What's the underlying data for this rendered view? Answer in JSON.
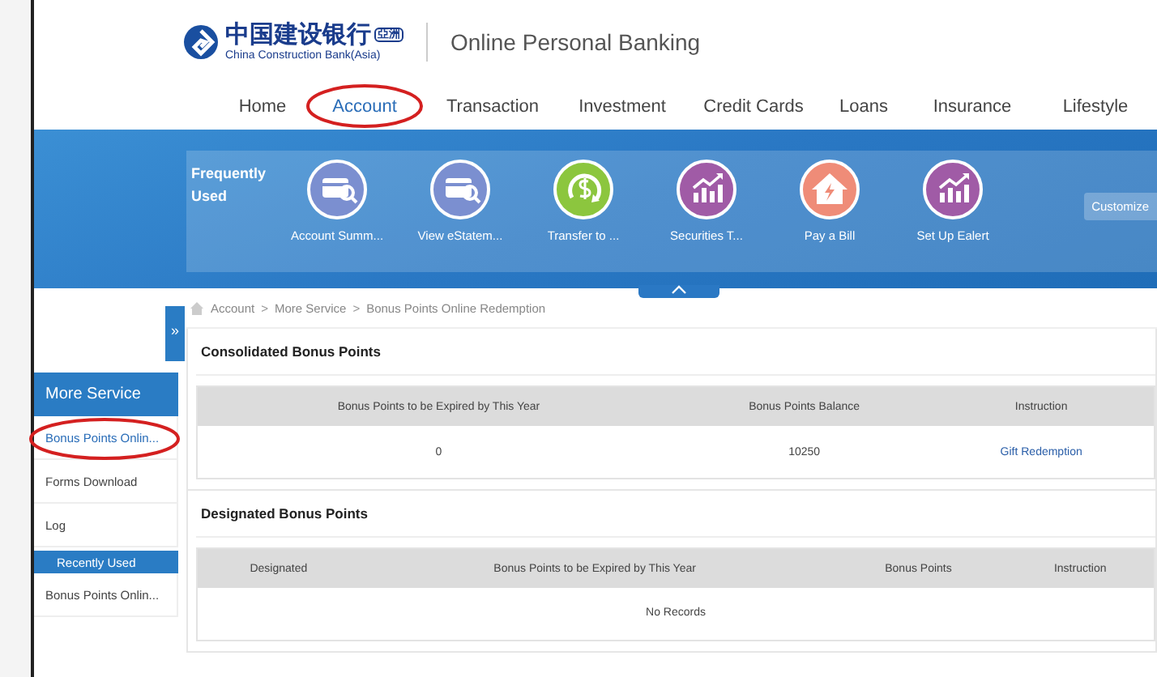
{
  "logo": {
    "chinese": "中国建设银行",
    "badge": "亞洲",
    "english": "China Construction Bank(Asia)"
  },
  "site_title": "Online Personal Banking",
  "nav": [
    {
      "label": "Home",
      "selected": false,
      "circled": false
    },
    {
      "label": "Account",
      "selected": true,
      "circled": true
    },
    {
      "label": "Transaction",
      "selected": false,
      "circled": false
    },
    {
      "label": "Investment",
      "selected": false,
      "circled": false
    },
    {
      "label": "Credit Cards",
      "selected": false,
      "circled": false
    },
    {
      "label": "Loans",
      "selected": false,
      "circled": false
    },
    {
      "label": "Insurance",
      "selected": false,
      "circled": false
    },
    {
      "label": "Lifestyle",
      "selected": false,
      "circled": false
    }
  ],
  "frequently_used": {
    "heading": "Frequently Used",
    "customize": "Customize",
    "items": [
      {
        "label": "Account Summ...",
        "kind": "card",
        "color": "#7b8fd0"
      },
      {
        "label": "View eStatem...",
        "kind": "card",
        "color": "#7b8fd0"
      },
      {
        "label": "Transfer to ...",
        "kind": "transfer",
        "color": "#8cc63e"
      },
      {
        "label": "Securities T...",
        "kind": "chart",
        "color": "#a05ba6"
      },
      {
        "label": "Pay a Bill",
        "kind": "house",
        "color": "#ef8c78"
      },
      {
        "label": "Set Up Ealert",
        "kind": "chart",
        "color": "#a05ba6"
      }
    ]
  },
  "expand_tab": "»",
  "sidebar": {
    "heading": "More Service",
    "items": [
      {
        "label": "Bonus Points Onlin...",
        "selected": true,
        "circled": true
      },
      {
        "label": "Forms Download",
        "selected": false,
        "circled": false
      },
      {
        "label": "Log",
        "selected": false,
        "circled": false
      }
    ],
    "recent_heading": "Recently Used",
    "recent_items": [
      {
        "label": "Bonus Points Onlin..."
      }
    ]
  },
  "breadcrumb": {
    "separator": ">",
    "items": [
      "Account",
      "More Service",
      "Bonus Points Online Redemption"
    ]
  },
  "consolidated": {
    "title": "Consolidated Bonus Points",
    "columns": [
      "Bonus Points to be Expired by This Year",
      "Bonus Points Balance",
      "Instruction"
    ],
    "rows": [
      [
        {
          "text": "0",
          "kind": "text"
        },
        {
          "text": "10250",
          "kind": "text"
        },
        {
          "text": "Gift Redemption",
          "kind": "link"
        }
      ]
    ]
  },
  "designated": {
    "title": "Designated Bonus Points",
    "columns": [
      "Designated",
      "Bonus Points to be Expired by This Year",
      "Bonus Points",
      "Instruction"
    ],
    "empty": "No Records"
  }
}
